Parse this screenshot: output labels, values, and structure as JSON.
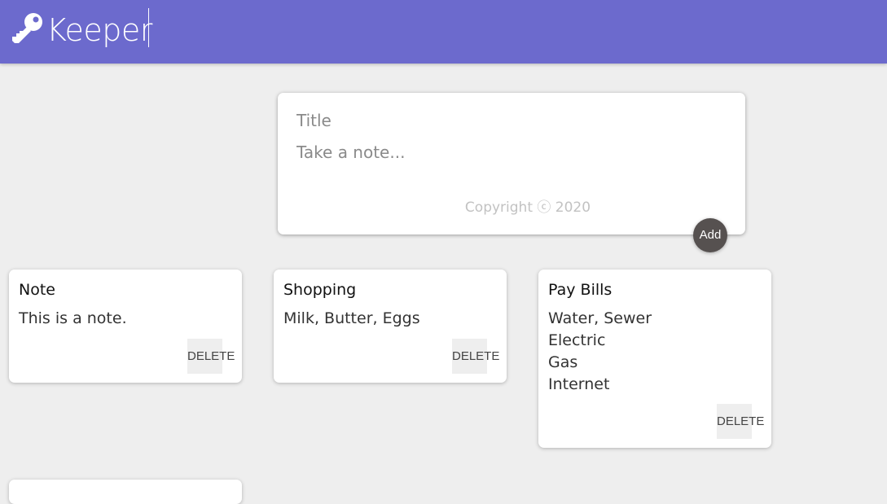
{
  "header": {
    "logo_icon": "key-icon",
    "title": "Keeper"
  },
  "create_area": {
    "title_placeholder": "Title",
    "content_placeholder": "Take a note...",
    "copyright": "Copyright ⓒ 2020",
    "add_label": "Add"
  },
  "notes": [
    {
      "title": "Note",
      "content": "This is a note.",
      "delete_label": "DELETE"
    },
    {
      "title": "Shopping",
      "content": "Milk, Butter, Eggs",
      "delete_label": "DELETE"
    },
    {
      "title": "Pay Bills",
      "content": "Water, Sewer\nElectric\nGas\nInternet",
      "delete_label": "DELETE"
    }
  ],
  "colors": {
    "header_bg": "#6c6acd",
    "page_bg": "#eeeeee",
    "add_button_bg": "#565150"
  }
}
